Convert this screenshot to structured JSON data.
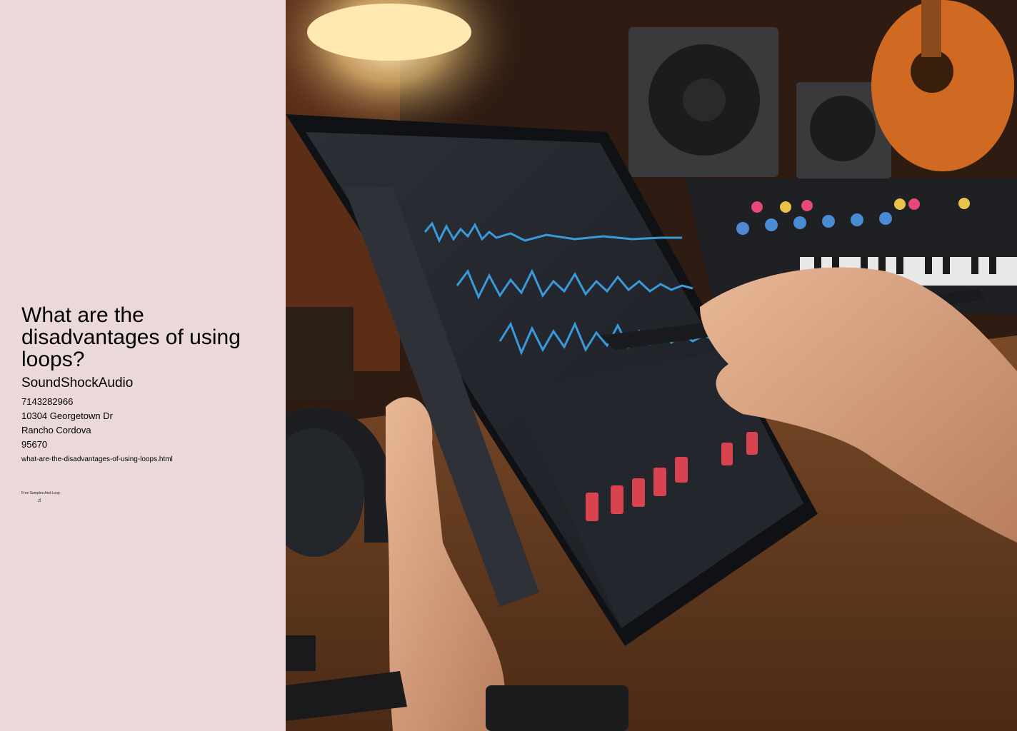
{
  "article": {
    "title": "What are the disadvantages of using loops?",
    "company": "SoundShockAudio",
    "phone": "7143282966",
    "street": "10304 Georgetown Dr",
    "city": "Rancho Cordova",
    "zip": "95670",
    "url": "what-are-the-disadvantages-of-using-loops.html",
    "tagline": "Free Samples And Loop",
    "music_icon": "♬"
  },
  "hero": {
    "alt": "Hand using a stylus on a tablet music production app in a studio"
  },
  "colors": {
    "sidebar_bg": "#ebd9d9",
    "waveform": "#3a9ad9",
    "fader_red": "#d9434f"
  }
}
